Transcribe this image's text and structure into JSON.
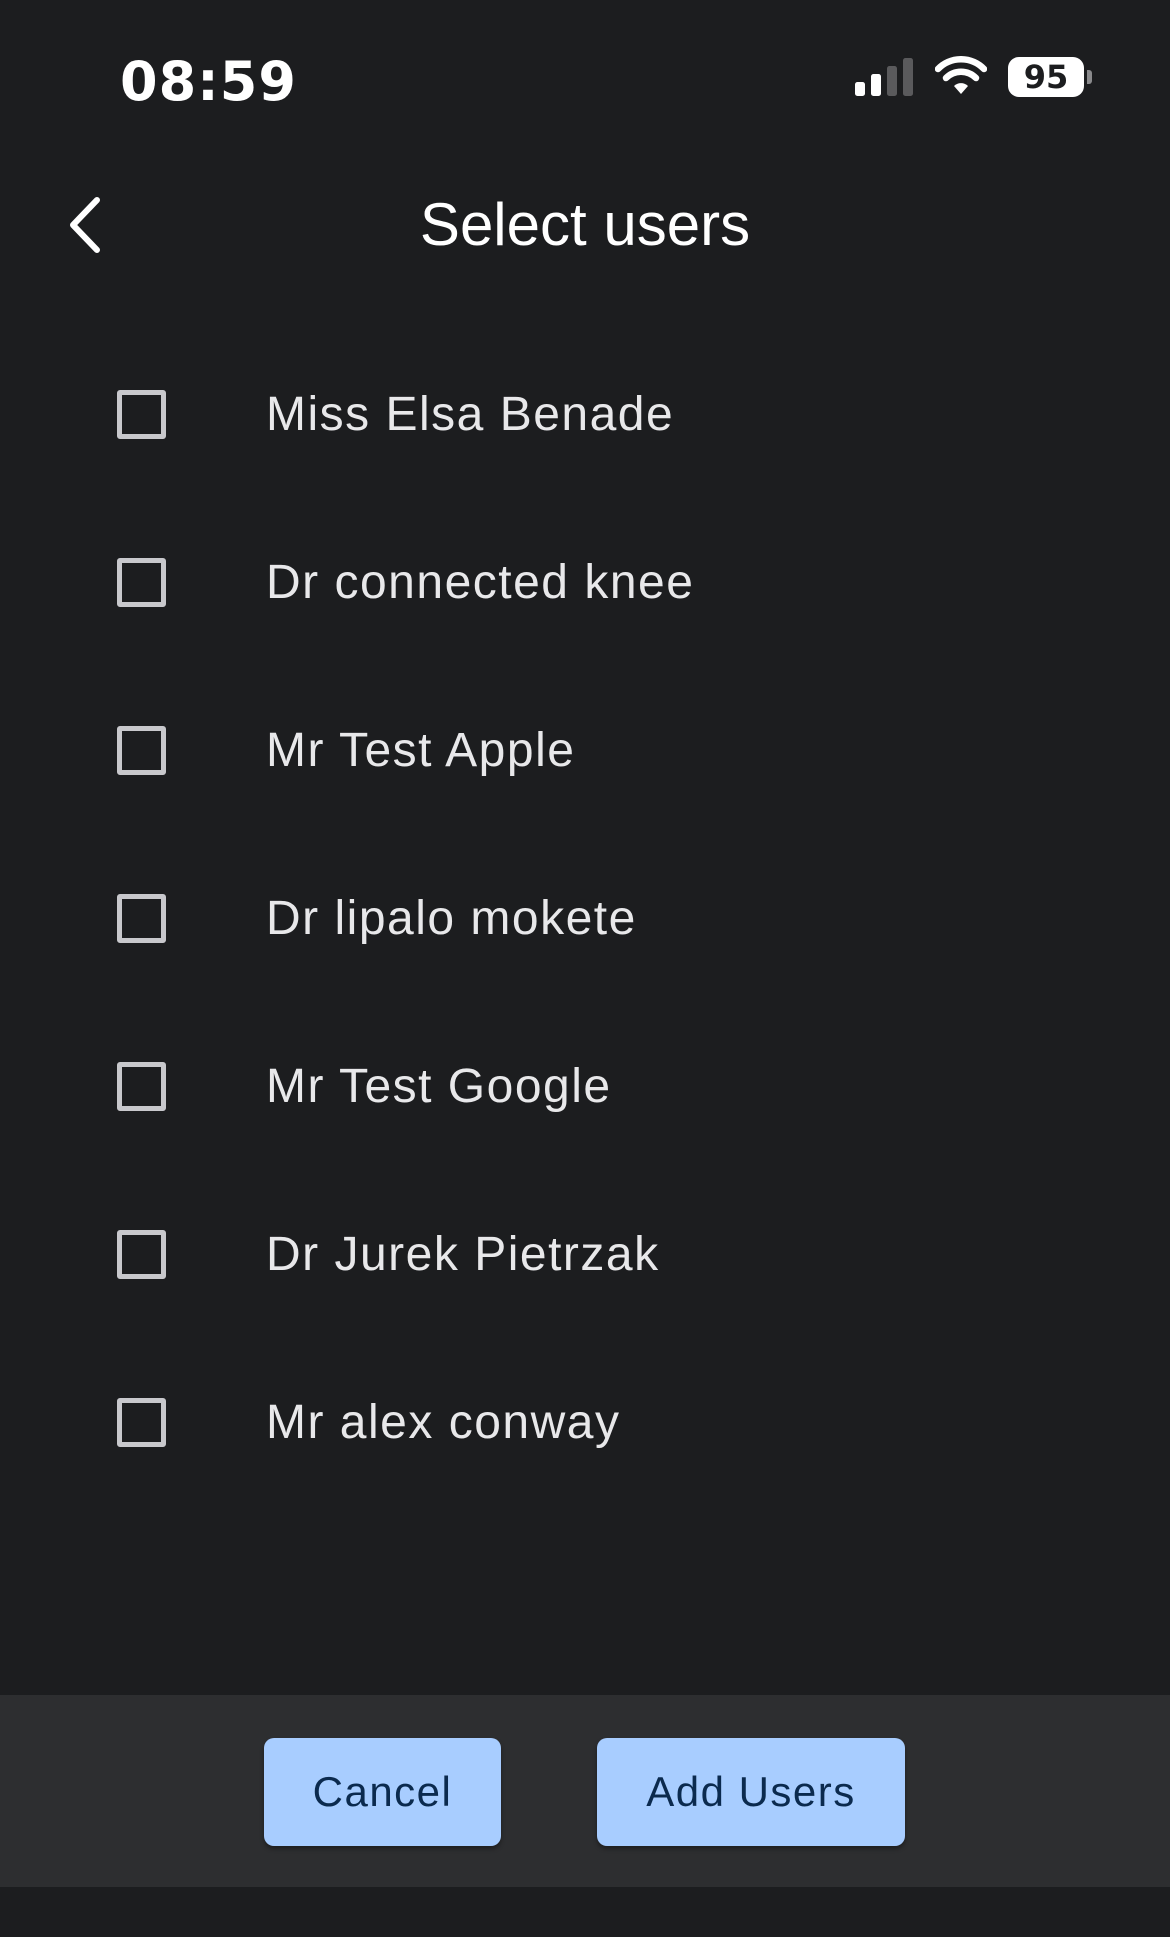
{
  "status_bar": {
    "time": "08:59",
    "battery_level": "95",
    "icons": [
      "signal-icon",
      "wifi-icon",
      "battery-icon"
    ]
  },
  "header": {
    "title": "Select users",
    "back_icon": "chevron-left-icon"
  },
  "users": [
    {
      "name": "Miss Elsa Benade",
      "checked": false
    },
    {
      "name": "Dr connected knee",
      "checked": false
    },
    {
      "name": "Mr Test Apple",
      "checked": false
    },
    {
      "name": "Dr lipalo mokete",
      "checked": false
    },
    {
      "name": "Mr Test Google",
      "checked": false
    },
    {
      "name": "Dr Jurek Pietrzak",
      "checked": false
    },
    {
      "name": "Mr alex conway",
      "checked": false
    }
  ],
  "actions": {
    "cancel_label": "Cancel",
    "add_label": "Add Users"
  },
  "colors": {
    "background": "#1c1d1f",
    "action_bar": "#2d2e30",
    "button_fill": "#a8cdff",
    "button_text": "#0b2a4e",
    "checkbox_border": "#c8c8cc"
  }
}
